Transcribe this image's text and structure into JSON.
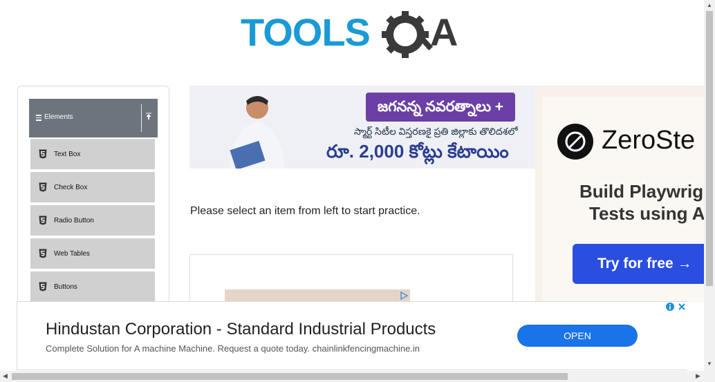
{
  "logo": {
    "text_left": "TOOLS",
    "text_right": "A",
    "accent_color": "#1a9ad6",
    "dark_color": "#3a3a3a"
  },
  "sidebar": {
    "group_title": "Elements",
    "toggle_icon": "arrow-up-icon",
    "items": [
      {
        "label": "Text Box",
        "icon": "html5-icon"
      },
      {
        "label": "Check Box",
        "icon": "html5-icon"
      },
      {
        "label": "Radio Button",
        "icon": "html5-icon"
      },
      {
        "label": "Web Tables",
        "icon": "html5-icon"
      },
      {
        "label": "Buttons",
        "icon": "html5-icon"
      }
    ]
  },
  "banner_ad": {
    "headline": "జగనన్న నవరత్నాలు +",
    "subtitle": "స్మార్ట్ సిటీల విస్తరణకై ప్రతి జిల్లాకు తొలిదశలో",
    "amount": "రూ. 2,000 కోట్లు కేటాయిం"
  },
  "side_ad": {
    "brand": "ZeroSte",
    "headline_line1": "Build Playwrigh",
    "headline_line2": "Tests using A",
    "cta": "Try for free →",
    "cta_color": "#2a4ee0"
  },
  "main": {
    "instruction": "Please select an item from left to start practice."
  },
  "bottom_ad": {
    "title": "Hindustan Corporation - Standard Industrial Products",
    "description": "Complete Solution for A machine Machine. Request a quote today. chainlinkfencingmachine.in",
    "button": "OPEN",
    "button_color": "#1a73e8"
  }
}
